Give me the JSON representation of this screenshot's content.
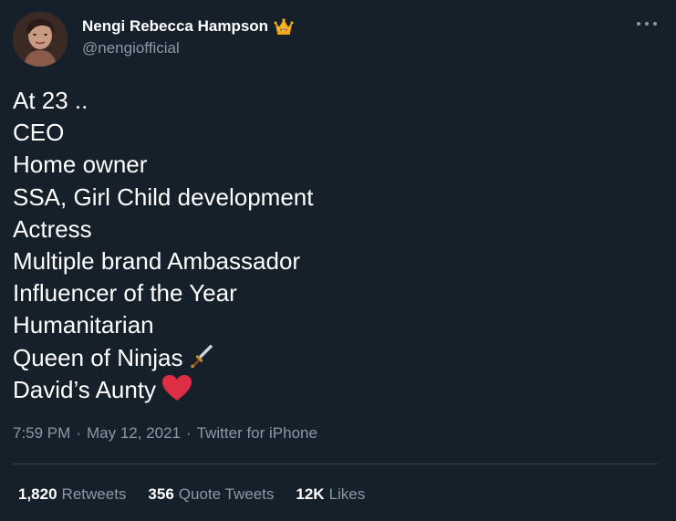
{
  "author": {
    "display_name": "Nengi Rebecca Hampson",
    "handle": "@nengiofficial",
    "badge_icon": "crown-icon"
  },
  "tweet": {
    "lines": [
      {
        "text": "At 23 ..",
        "emoji": null
      },
      {
        "text": "CEO",
        "emoji": null
      },
      {
        "text": "Home owner",
        "emoji": null
      },
      {
        "text": "SSA, Girl Child development",
        "emoji": null
      },
      {
        "text": "Actress",
        "emoji": null
      },
      {
        "text": "Multiple brand Ambassador",
        "emoji": null
      },
      {
        "text": "Influencer of the Year",
        "emoji": null
      },
      {
        "text": "Humanitarian",
        "emoji": null
      },
      {
        "text": "Queen of Ninjas",
        "emoji": "dagger-icon"
      },
      {
        "text": "David’s Aunty",
        "emoji": "heart-icon"
      }
    ]
  },
  "meta": {
    "time": "7:59 PM",
    "separator": "·",
    "date": "May 12, 2021",
    "source": "Twitter for iPhone"
  },
  "stats": {
    "retweets": {
      "value": "1,820",
      "label": "Retweets"
    },
    "quote_tweets": {
      "value": "356",
      "label": "Quote Tweets"
    },
    "likes": {
      "value": "12K",
      "label": "Likes"
    }
  },
  "colors": {
    "background": "#15202b",
    "text_primary": "#ffffff",
    "text_secondary": "#8b98a5",
    "divider": "#38444d",
    "heart": "#e0245e"
  }
}
